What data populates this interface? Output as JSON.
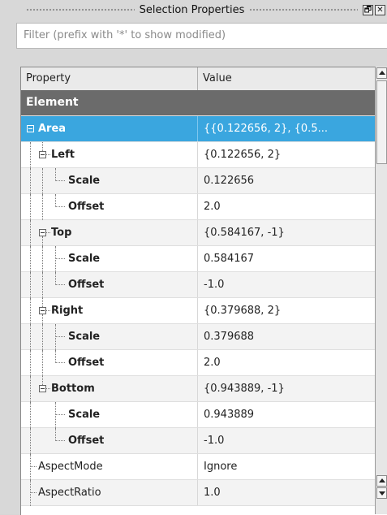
{
  "window": {
    "title": "Selection Properties",
    "float_btn": "🗗",
    "close_btn": "✕"
  },
  "filter": {
    "placeholder": "Filter (prefix with '*' to show modified)"
  },
  "table": {
    "headers": {
      "property": "Property",
      "value": "Value"
    },
    "rows": [
      {
        "label": "Element",
        "value": ""
      },
      {
        "label": "Area",
        "value": "{{0.122656, 2}, {0.5..."
      },
      {
        "label": "Left",
        "value": "{0.122656, 2}"
      },
      {
        "label": "Scale",
        "value": "0.122656"
      },
      {
        "label": "Offset",
        "value": "2.0"
      },
      {
        "label": "Top",
        "value": "{0.584167, -1}"
      },
      {
        "label": "Scale",
        "value": "0.584167"
      },
      {
        "label": "Offset",
        "value": "-1.0"
      },
      {
        "label": "Right",
        "value": "{0.379688, 2}"
      },
      {
        "label": "Scale",
        "value": "0.379688"
      },
      {
        "label": "Offset",
        "value": "2.0"
      },
      {
        "label": "Bottom",
        "value": "{0.943889, -1}"
      },
      {
        "label": "Scale",
        "value": "0.943889"
      },
      {
        "label": "Offset",
        "value": "-1.0"
      },
      {
        "label": "AspectMode",
        "value": "Ignore"
      },
      {
        "label": "AspectRatio",
        "value": "1.0"
      }
    ]
  },
  "colors": {
    "selection": "#3aa6df",
    "category": "#6b6b6b"
  }
}
